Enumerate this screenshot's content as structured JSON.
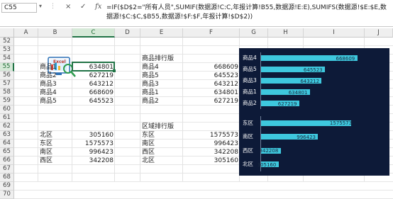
{
  "formula_bar": {
    "name_box": "C55",
    "formula": "=IF($D$2=\"所有人员\",SUMIF(数据源!C:C,年报计算!B55,数据源!E:E),SUMIFS(数据源!$E:$E,数据源!$C:$C,$B55,数据源!$F:$F,年报计算!$D$2))",
    "cancel_icon": "×",
    "enter_icon": "✓",
    "fx_label": "fx"
  },
  "columns": [
    "A",
    "B",
    "C",
    "D",
    "E",
    "F",
    "G",
    "H",
    "I",
    "J"
  ],
  "rows": [
    "52",
    "53",
    "54",
    "55",
    "56",
    "57",
    "58",
    "59",
    "60",
    "61",
    "62",
    "63",
    "64",
    "65",
    "66",
    "67",
    "68",
    "69",
    "70"
  ],
  "active_cell": {
    "column": "C",
    "row": "55"
  },
  "logo_text": "Excel",
  "products_source": [
    {
      "name": "商品1",
      "value": "634801"
    },
    {
      "name": "商品2",
      "value": "627219"
    },
    {
      "name": "商品3",
      "value": "643212"
    },
    {
      "name": "商品4",
      "value": "668609"
    },
    {
      "name": "商品5",
      "value": "645523"
    }
  ],
  "product_rank": {
    "title": "商品排行版",
    "rows": [
      {
        "name": "商品4",
        "value": "668609"
      },
      {
        "name": "商品5",
        "value": "645523"
      },
      {
        "name": "商品3",
        "value": "643212"
      },
      {
        "name": "商品1",
        "value": "634801"
      },
      {
        "name": "商品2",
        "value": "627219"
      }
    ]
  },
  "regions_source": [
    {
      "name": "北区",
      "value": "305160"
    },
    {
      "name": "东区",
      "value": "1575573"
    },
    {
      "name": "南区",
      "value": "996423"
    },
    {
      "name": "西区",
      "value": "342208"
    }
  ],
  "region_rank": {
    "title": "区域排行版",
    "rows": [
      {
        "name": "东区",
        "value": "1575573"
      },
      {
        "name": "南区",
        "value": "996423"
      },
      {
        "name": "西区",
        "value": "342208"
      },
      {
        "name": "北区",
        "value": "305160"
      }
    ]
  },
  "colors": {
    "chart_bg": "#0d1a38",
    "bar": "#3ec8de",
    "selection": "#217346"
  },
  "chart_data": [
    {
      "type": "bar",
      "orientation": "horizontal",
      "categories": [
        "商品4",
        "商品5",
        "商品3",
        "商品1",
        "商品2"
      ],
      "values": [
        668609,
        645523,
        643212,
        634801,
        627219
      ],
      "xlim": [
        600000,
        680000
      ]
    },
    {
      "type": "bar",
      "orientation": "horizontal",
      "categories": [
        "东区",
        "南区",
        "西区",
        "北区"
      ],
      "values": [
        1575573,
        996423,
        342208,
        305160
      ],
      "xlim": [
        0,
        1800000
      ]
    }
  ]
}
